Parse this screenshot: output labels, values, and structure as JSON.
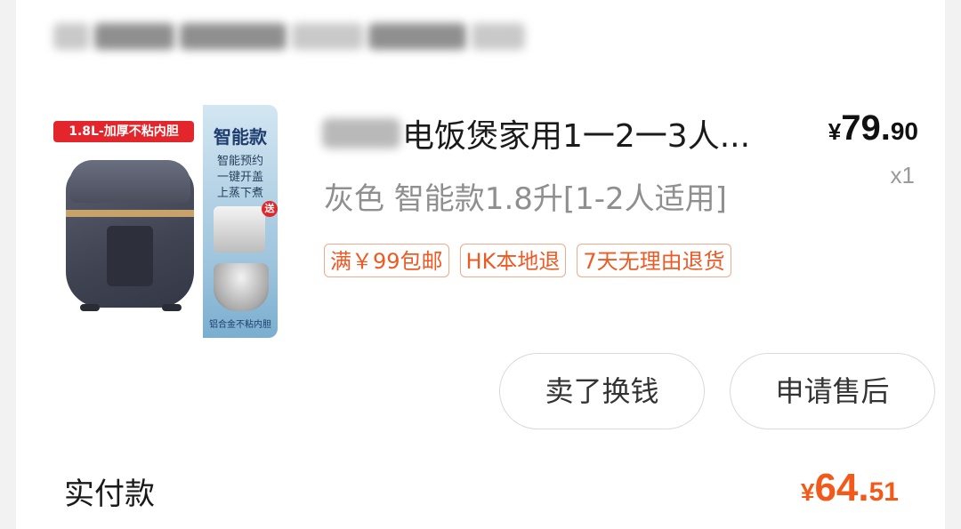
{
  "product": {
    "image_badge": "1.8L-加厚不粘内胆",
    "image_side_title": "智能款",
    "image_side_lines": [
      "智能预约",
      "一键开盖",
      "上蒸下煮"
    ],
    "image_gift": "送",
    "image_pot_caption": "铝合金不粘内胆",
    "title": "电饭煲家用1一2一3人...",
    "variant": "灰色 智能款1.8升[1-2人适用]",
    "price_symbol": "¥",
    "price_int": "79.",
    "price_dec": "90",
    "quantity": "x1",
    "tags": [
      "满￥99包邮",
      "HK本地退",
      "7天无理由退货"
    ]
  },
  "actions": {
    "sell_label": "卖了换钱",
    "after_sale_label": "申请售后"
  },
  "payment": {
    "label": "实付款",
    "symbol": "¥",
    "amount_int": "64.",
    "amount_dec": "51"
  },
  "colors": {
    "accent": "#f35a1a",
    "tag_text": "#ee5a24",
    "tag_border": "#f2a98c",
    "badge": "#e2262b"
  }
}
